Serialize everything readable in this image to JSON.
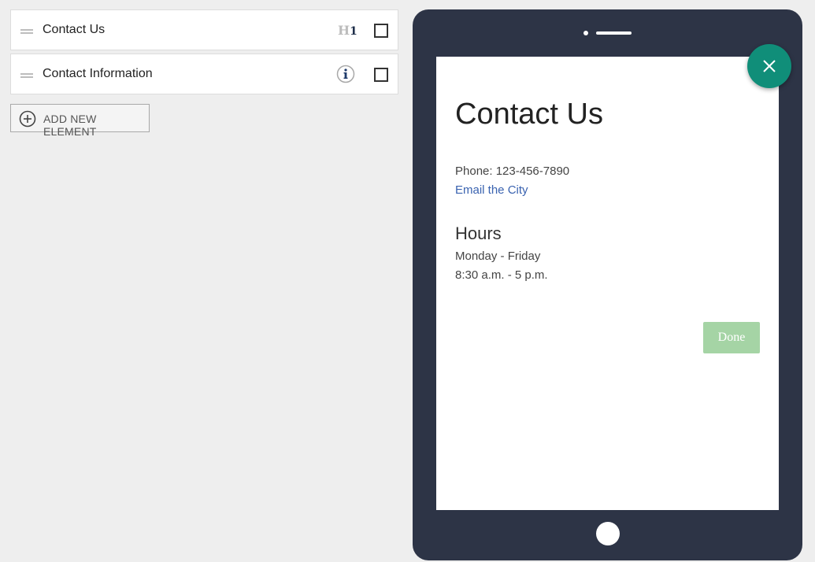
{
  "elements": [
    {
      "label": "Contact Us",
      "type_icon": "h1-icon",
      "type_h": "H",
      "type_n": "1"
    },
    {
      "label": "Contact Information",
      "type_icon": "info-icon"
    }
  ],
  "add_button": {
    "label": "ADD NEW ELEMENT",
    "icon": "plus-circle-icon"
  },
  "preview": {
    "title": "Contact Us",
    "phone": "Phone: 123-456-7890",
    "email_link": "Email the City",
    "hours_title": "Hours",
    "hours_days": "Monday - Friday",
    "hours_time": "8:30 a.m. - 5 p.m.",
    "done_label": "Done"
  },
  "colors": {
    "accent": "#108e79",
    "device": "#2d3446",
    "link": "#3a63b0",
    "done": "#a5d4a5"
  }
}
